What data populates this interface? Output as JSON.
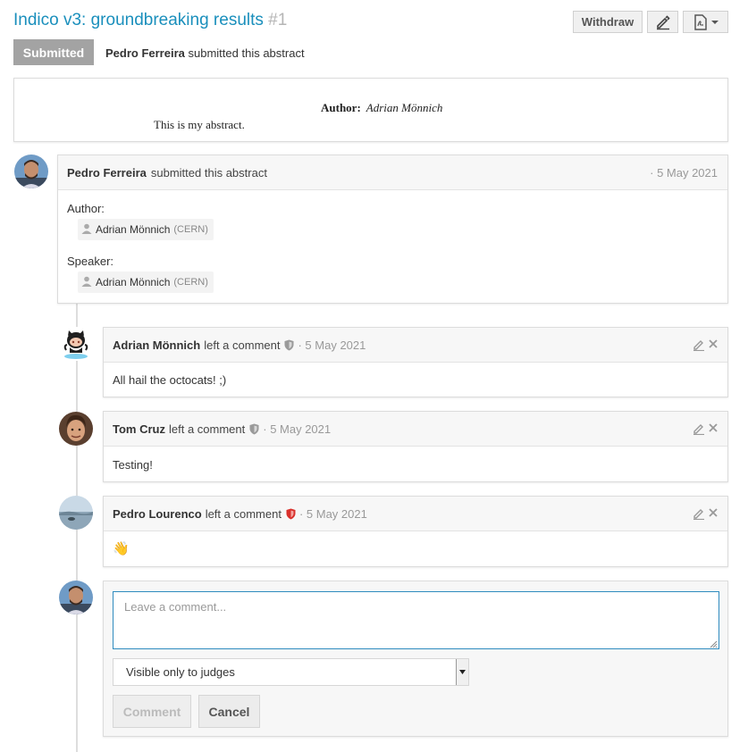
{
  "header": {
    "title": "Indico v3: groundbreaking results",
    "number": "#1",
    "withdraw_label": "Withdraw",
    "edit_icon": "pencil-icon",
    "pdf_icon": "pdf-icon"
  },
  "status": {
    "badge": "Submitted",
    "actor": "Pedro Ferreira",
    "action": "submitted this abstract"
  },
  "abstract": {
    "author_label": "Author:",
    "author_name": "Adrian Mönnich",
    "body": "This is my abstract."
  },
  "submission": {
    "actor": "Pedro Ferreira",
    "action": "submitted this abstract",
    "date": "· 5 May 2021",
    "author_label": "Author:",
    "author_name": "Adrian Mönnich",
    "author_aff": "(CERN)",
    "speaker_label": "Speaker:",
    "speaker_name": "Adrian Mönnich",
    "speaker_aff": "(CERN)"
  },
  "comments": [
    {
      "author": "Adrian Mönnich",
      "action": "left a comment",
      "date": "· 5 May 2021",
      "text": "All hail the octocats! ;)",
      "shield_color": "#9a9a9a"
    },
    {
      "author": "Tom Cruz",
      "action": "left a comment",
      "date": "· 5 May 2021",
      "text": "Testing!",
      "shield_color": "#9a9a9a"
    },
    {
      "author": "Pedro Lourenco",
      "action": "left a comment",
      "date": "· 5 May 2021",
      "text": "👋",
      "shield_color": "#d9302b"
    }
  ],
  "reply": {
    "placeholder": "Leave a comment...",
    "visibility": "Visible only to judges",
    "submit_label": "Comment",
    "cancel_label": "Cancel"
  },
  "colors": {
    "link": "#1a8fbc",
    "badge": "#a3a3a3",
    "focus": "#2e8bbf"
  }
}
